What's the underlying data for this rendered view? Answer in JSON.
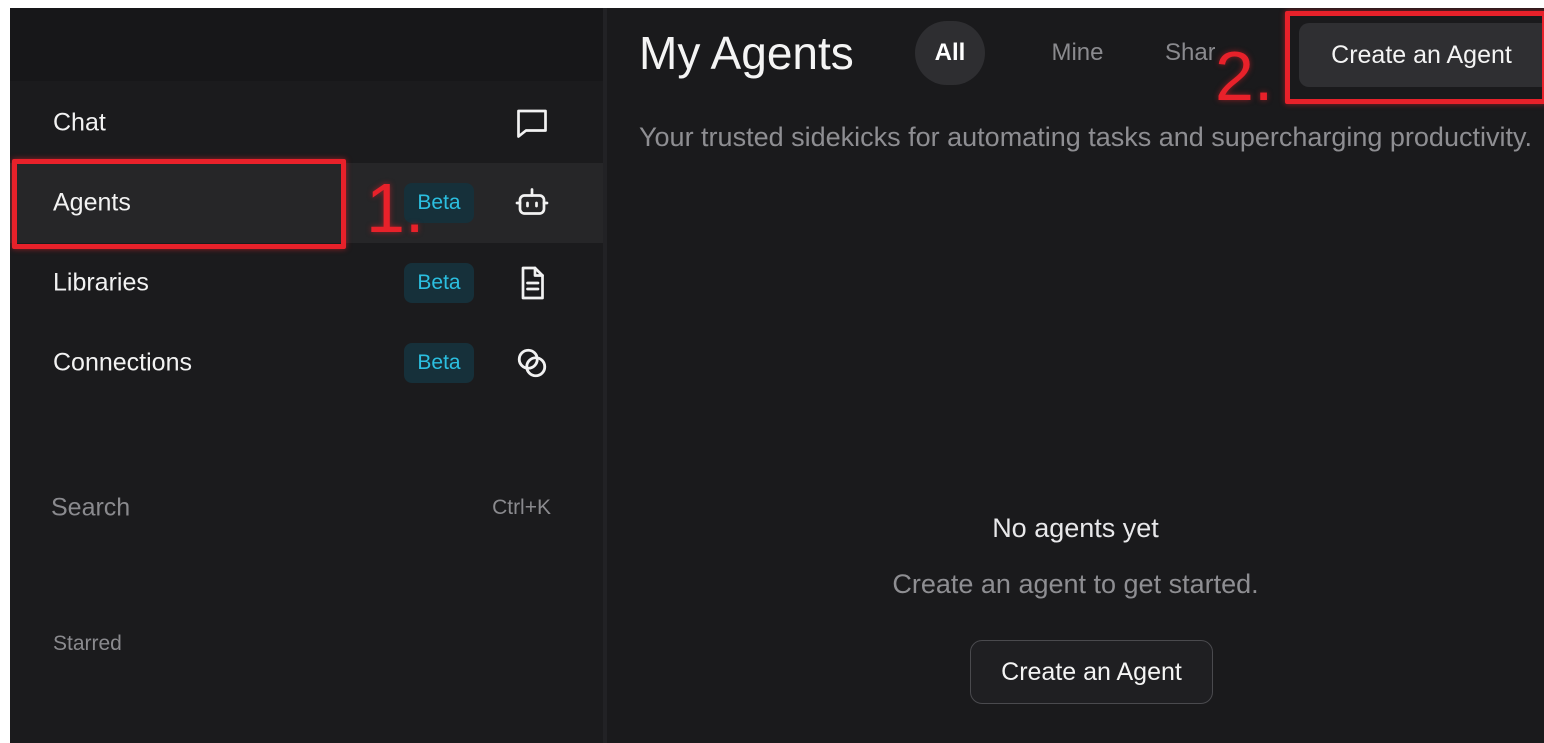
{
  "sidebar": {
    "items": [
      {
        "label": "Chat",
        "badge": "",
        "icon": "chat-bubble-icon"
      },
      {
        "label": "Agents",
        "badge": "Beta",
        "icon": "robot-icon"
      },
      {
        "label": "Libraries",
        "badge": "Beta",
        "icon": "document-icon"
      },
      {
        "label": "Connections",
        "badge": "Beta",
        "icon": "linked-circles-icon"
      }
    ],
    "search": {
      "label": "Search",
      "shortcut": "Ctrl+K"
    },
    "starred_label": "Starred"
  },
  "main": {
    "title": "My Agents",
    "tabs": [
      {
        "label": "All",
        "selected": true
      },
      {
        "label": "Mine",
        "selected": false
      },
      {
        "label": "Shared",
        "selected": false
      }
    ],
    "create_button": "Create an Agent",
    "subtitle": "Your trusted sidekicks for automating tasks and supercharging productivity.",
    "empty_state": {
      "title": "No agents yet",
      "description": "Create an agent to get started.",
      "button": "Create an Agent"
    }
  },
  "annotations": [
    {
      "number": "1."
    },
    {
      "number": "2."
    }
  ],
  "colors": {
    "background": "#1a1a1c",
    "beta_badge_bg": "#16303a",
    "beta_badge_text": "#2bbfe0",
    "annotation": "#e8212a"
  }
}
